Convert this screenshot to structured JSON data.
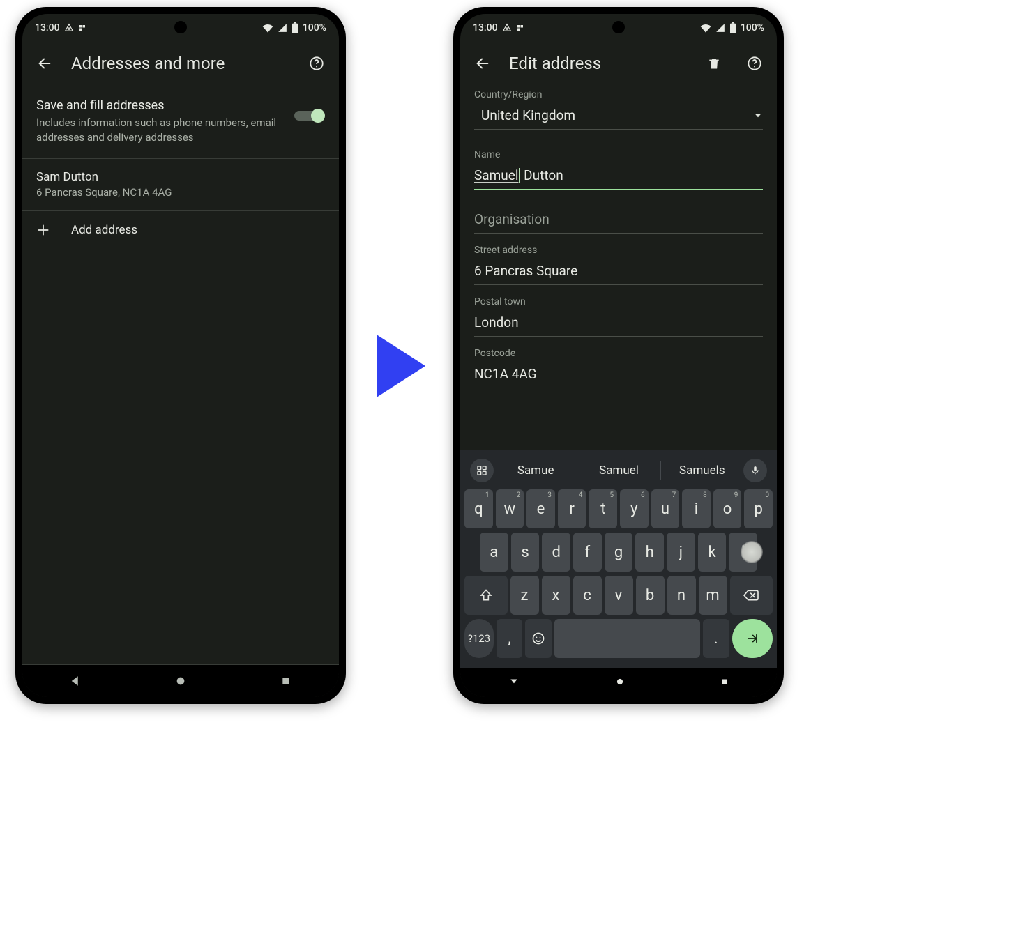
{
  "status": {
    "time": "13:00",
    "battery": "100%"
  },
  "left": {
    "title": "Addresses and more",
    "toggle": {
      "title": "Save and fill addresses",
      "subtitle": "Includes information such as phone numbers, email addresses and delivery addresses"
    },
    "saved": {
      "name": "Sam Dutton",
      "address": "6 Pancras Square, NC1A 4AG"
    },
    "add_label": "Add address"
  },
  "right": {
    "title": "Edit address",
    "fields": {
      "country": {
        "label": "Country/Region",
        "value": "United Kingdom"
      },
      "name": {
        "label": "Name",
        "value_pre": "Samuel",
        "value_post": " Dutton"
      },
      "org": {
        "label": "Organisation"
      },
      "street": {
        "label": "Street address",
        "value": "6 Pancras Square"
      },
      "town": {
        "label": "Postal town",
        "value": "London"
      },
      "postcode": {
        "label": "Postcode",
        "value": "NC1A 4AG"
      }
    }
  },
  "keyboard": {
    "suggestions": [
      "Samue",
      "Samuel",
      "Samuels"
    ],
    "row1": [
      "q",
      "w",
      "e",
      "r",
      "t",
      "y",
      "u",
      "i",
      "o",
      "p"
    ],
    "row1hints": [
      "1",
      "2",
      "3",
      "4",
      "5",
      "6",
      "7",
      "8",
      "9",
      "0"
    ],
    "row2": [
      "a",
      "s",
      "d",
      "f",
      "g",
      "h",
      "j",
      "k",
      "l"
    ],
    "row3": [
      "z",
      "x",
      "c",
      "v",
      "b",
      "n",
      "m"
    ],
    "numkey": "?123",
    "comma": ",",
    "period": "."
  }
}
